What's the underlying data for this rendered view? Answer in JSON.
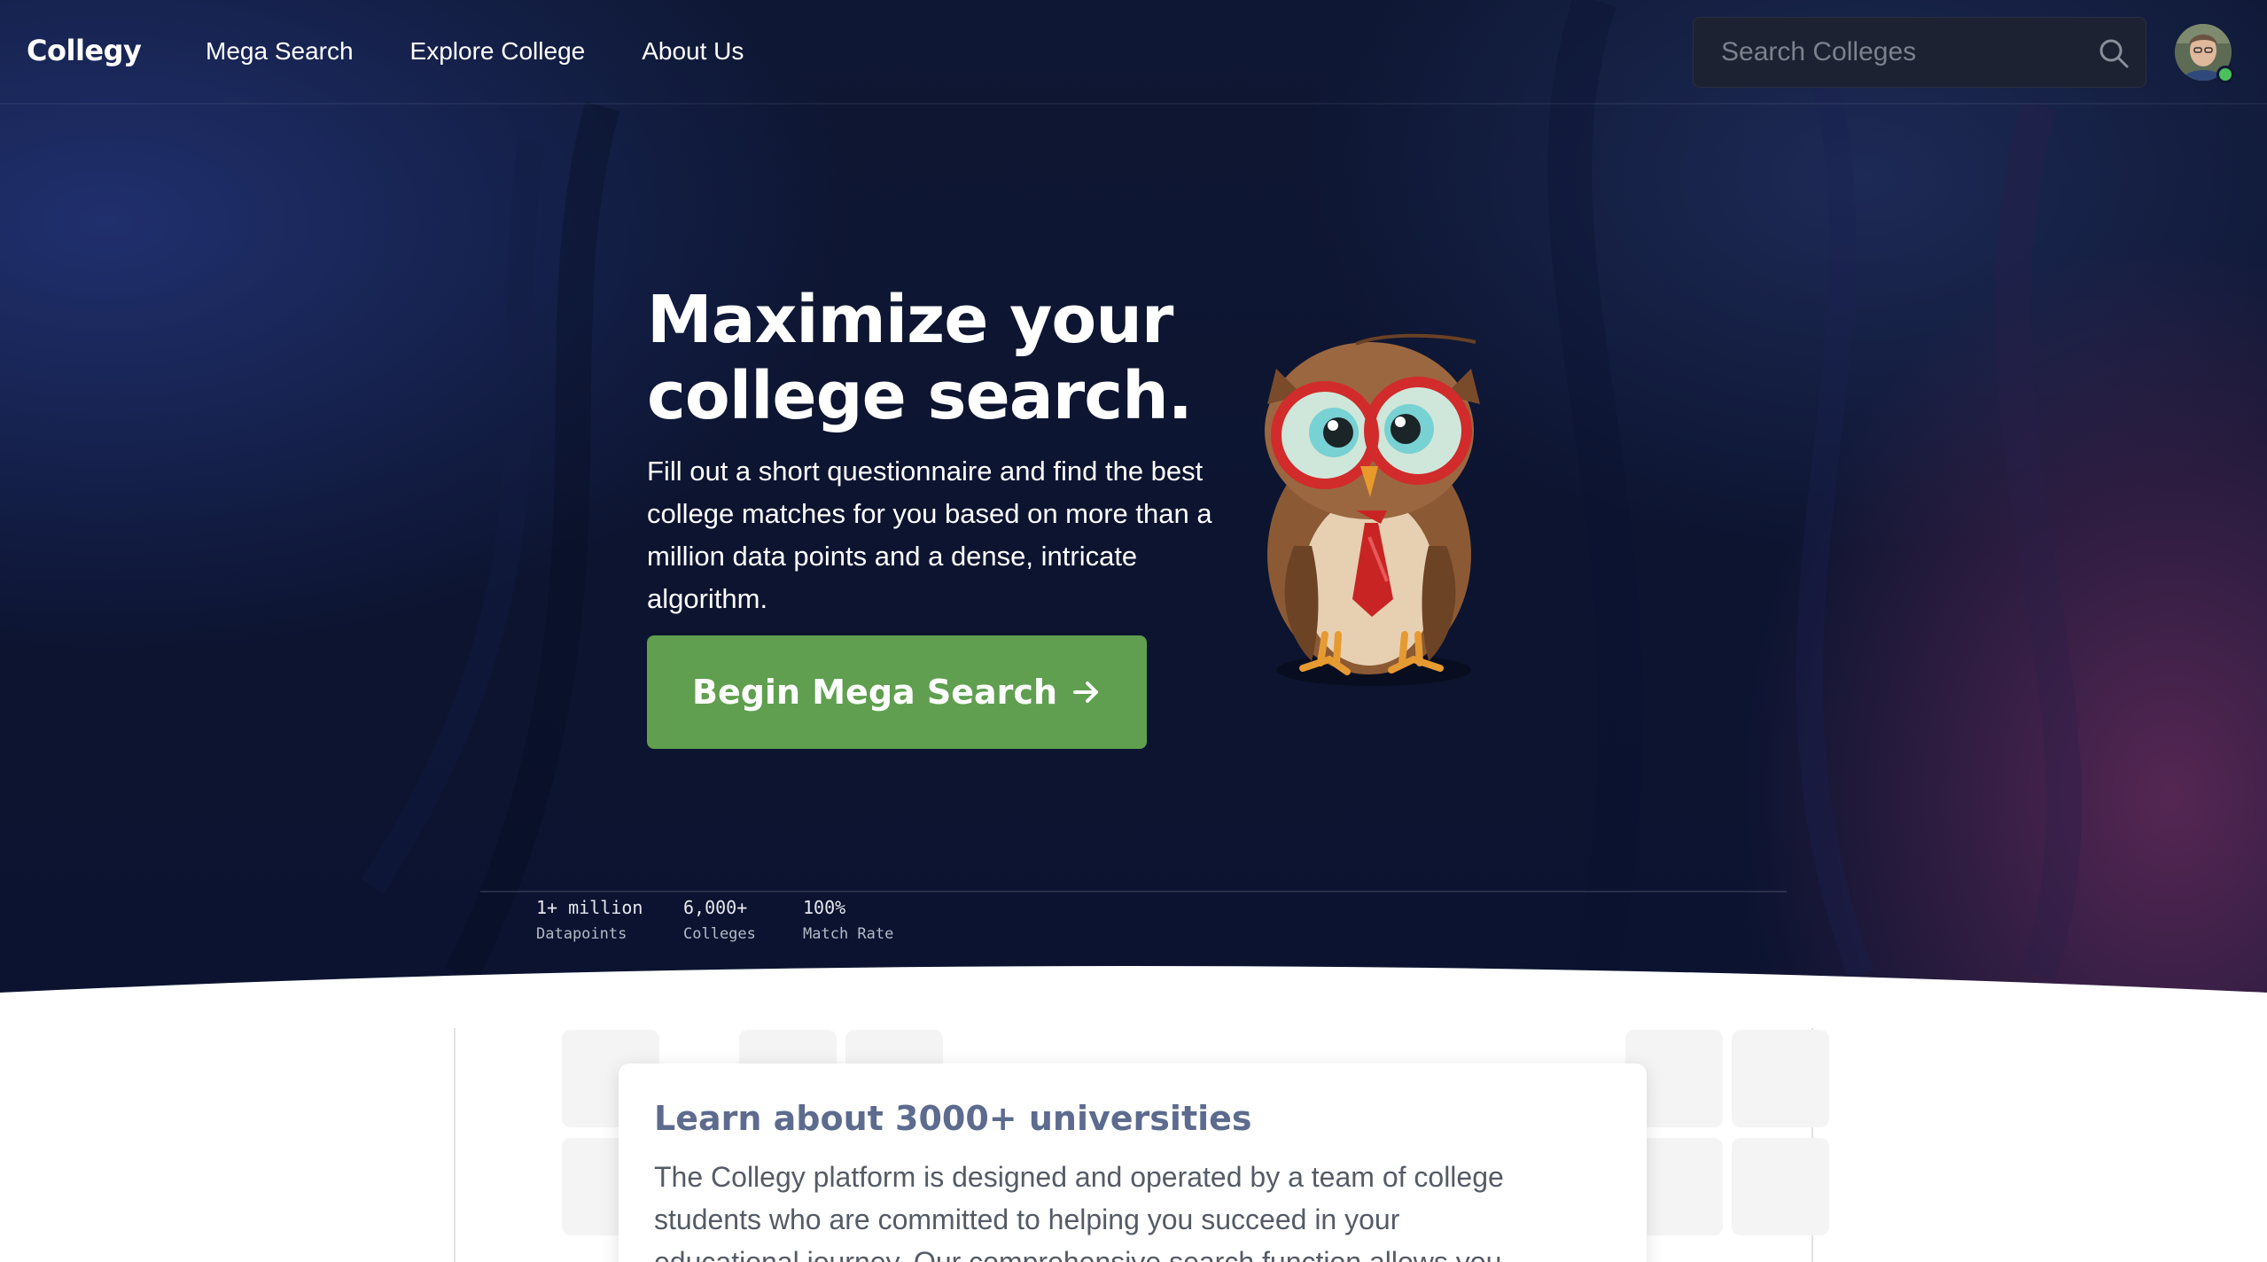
{
  "nav": {
    "brand": "Collegy",
    "links": [
      "Mega Search",
      "Explore College",
      "About Us"
    ],
    "search_placeholder": "Search Colleges"
  },
  "hero": {
    "headline_line1": "Maximize your",
    "headline_line2": "college search.",
    "subtext": "Fill out a short questionnaire and find the best college matches for you based on more than a million data points and a dense, intricate algorithm.",
    "cta_label": "Begin Mega Search",
    "cta_icon": "arrow-right-icon",
    "illustration": "owl-mascot"
  },
  "stats": [
    {
      "value": "1+ million",
      "label": "Datapoints"
    },
    {
      "value": "6,000+",
      "label": "Colleges"
    },
    {
      "value": "100%",
      "label": "Match Rate"
    }
  ],
  "info_card": {
    "title": "Learn about 3000+ universities",
    "body": "The Collegy platform is designed and operated by a team of college students who are committed to helping you succeed in your educational journey. Our comprehensive search function allows you"
  },
  "colors": {
    "hero_bg": "#0e1733",
    "cta_green": "#5f9f4f",
    "card_title": "#5c6b8e",
    "online_status": "#4cc05d"
  }
}
